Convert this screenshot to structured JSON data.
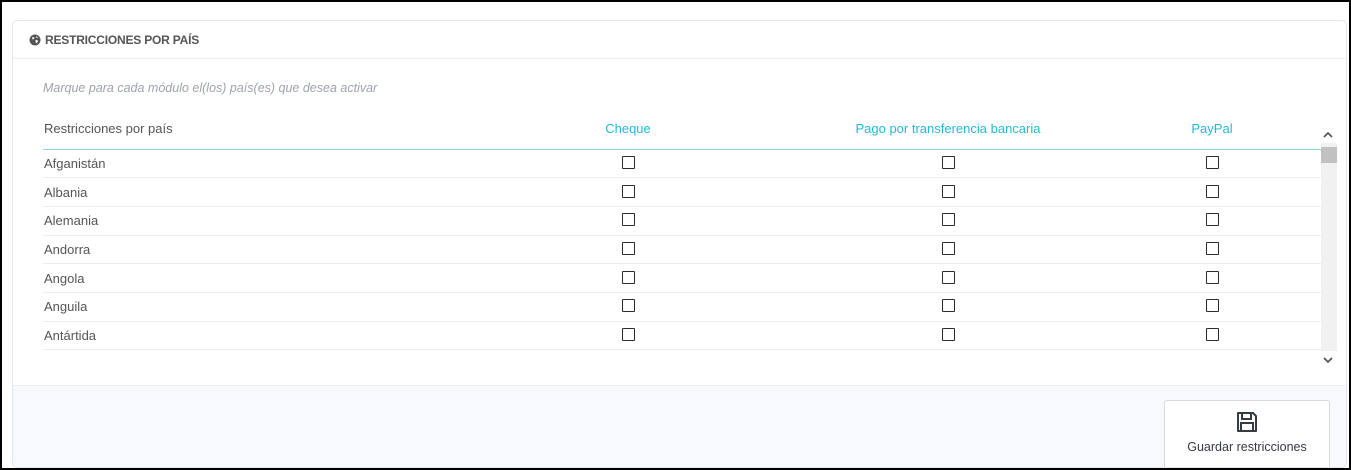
{
  "panel": {
    "heading": "RESTRICCIONES POR PAÍS",
    "help_text": "Marque para cada módulo el(los) país(es) que desea activar"
  },
  "table": {
    "headers": [
      "Restricciones por país",
      "Cheque",
      "Pago por transferencia bancaria",
      "PayPal"
    ],
    "rows": [
      {
        "country": "Afganistán",
        "checks": [
          false,
          false,
          false
        ]
      },
      {
        "country": "Albania",
        "checks": [
          false,
          false,
          false
        ]
      },
      {
        "country": "Alemania",
        "checks": [
          false,
          false,
          false
        ]
      },
      {
        "country": "Andorra",
        "checks": [
          false,
          false,
          false
        ]
      },
      {
        "country": "Angola",
        "checks": [
          false,
          false,
          false
        ]
      },
      {
        "country": "Anguila",
        "checks": [
          false,
          false,
          false
        ]
      },
      {
        "country": "Antártida",
        "checks": [
          false,
          false,
          false
        ]
      }
    ]
  },
  "footer": {
    "save_label": "Guardar restricciones"
  },
  "icons": {
    "heading_icon": "globe-icon",
    "save_icon": "floppy-disk-icon",
    "scroll_up": "chevron-up-icon",
    "scroll_down": "chevron-down-icon"
  },
  "colors": {
    "accent": "#25b9d7",
    "header_border": "#94d5e8",
    "footer_bg": "#f7f9fc",
    "text": "#555555",
    "muted": "#9ea4aa"
  }
}
